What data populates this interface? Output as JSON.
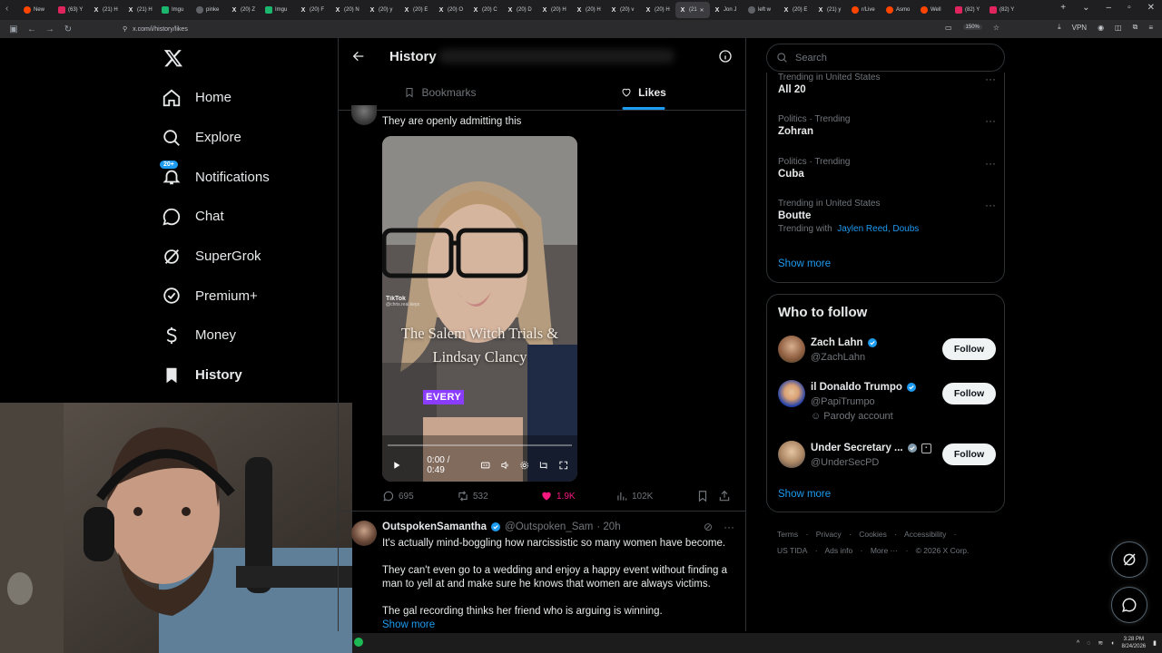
{
  "browser": {
    "tabs": [
      {
        "label": "New",
        "icon": "reddit"
      },
      {
        "label": "(63) Y",
        "icon": "youtube"
      },
      {
        "label": "(21) H",
        "icon": "x"
      },
      {
        "label": "(21) H",
        "icon": "x"
      },
      {
        "label": "Imgu",
        "icon": "imgur"
      },
      {
        "label": "pinke",
        "icon": "globe"
      },
      {
        "label": "(20) Z",
        "icon": "x"
      },
      {
        "label": "Imgu",
        "icon": "imgur"
      },
      {
        "label": "(20) F",
        "icon": "x"
      },
      {
        "label": "(20) N",
        "icon": "x"
      },
      {
        "label": "(20) y",
        "icon": "x"
      },
      {
        "label": "(20) E",
        "icon": "x"
      },
      {
        "label": "(20) O",
        "icon": "x"
      },
      {
        "label": "(20) C",
        "icon": "x"
      },
      {
        "label": "(20) D",
        "icon": "x"
      },
      {
        "label": "(20) H",
        "icon": "x"
      },
      {
        "label": "(20) H",
        "icon": "x"
      },
      {
        "label": "(20) v",
        "icon": "x"
      },
      {
        "label": "(20) H",
        "icon": "x"
      },
      {
        "label": "(21",
        "icon": "x",
        "active": true
      },
      {
        "label": "Jon J",
        "icon": "x"
      },
      {
        "label": "left w",
        "icon": "globe"
      },
      {
        "label": "(20) E",
        "icon": "x"
      },
      {
        "label": "(21) y",
        "icon": "x"
      },
      {
        "label": "r/Live",
        "icon": "reddit"
      },
      {
        "label": "Asmo",
        "icon": "reddit"
      },
      {
        "label": "Well",
        "icon": "reddit"
      },
      {
        "label": "(82) Y",
        "icon": "youtube"
      },
      {
        "label": "(82) Y",
        "icon": "youtube"
      }
    ],
    "url": "x.com/i/history/likes",
    "zoom": "150%",
    "vpn": "VPN"
  },
  "nav": {
    "logo": "x-logo-icon",
    "items": [
      {
        "label": "Home",
        "icon": "home-icon"
      },
      {
        "label": "Explore",
        "icon": "search-icon"
      },
      {
        "label": "Notifications",
        "icon": "bell-icon",
        "badge": "20+"
      },
      {
        "label": "Chat",
        "icon": "chat-icon"
      },
      {
        "label": "SuperGrok",
        "icon": "grok-icon"
      },
      {
        "label": "Premium+",
        "icon": "premium-icon"
      },
      {
        "label": "Money",
        "icon": "money-icon"
      },
      {
        "label": "History",
        "icon": "bookmark-icon",
        "active": true
      }
    ]
  },
  "main": {
    "title": "History",
    "tabs": [
      {
        "label": "Bookmarks",
        "active": false
      },
      {
        "label": "Likes",
        "active": true
      }
    ],
    "tweet1": {
      "text": "They are openly admitting this",
      "video": {
        "overlay_title_line1": "The Salem Witch Trials &",
        "overlay_title_line2": "Lindsay Clancy",
        "caption": "EVERY",
        "tiktok_label": "TikTok",
        "tiktok_user": "@chris.real.keys",
        "time": "0:00 / 0:49",
        "progress": 0
      },
      "stats": {
        "replies": "695",
        "reposts": "532",
        "likes": "1.9K",
        "views": "102K"
      }
    },
    "tweet2": {
      "name": "OutspokenSamantha",
      "handle": "@Outspoken_Sam",
      "time": "· 20h",
      "para1": "It's actually mind-boggling how narcissistic so many women have become.",
      "para2": "They can't even go to a wedding and enjoy a happy event without finding a man to yell at and make sure he knows that women are always victims.",
      "para3": "The gal recording thinks her friend who is arguing is winning.",
      "show_more": "Show more"
    }
  },
  "sidebar": {
    "search_placeholder": "Search",
    "trends": [
      {
        "context": "Trending in United States",
        "name": "All 20"
      },
      {
        "context": "Politics · Trending",
        "name": "Zohran"
      },
      {
        "context": "Politics · Trending",
        "name": "Cuba"
      },
      {
        "context": "Trending in United States",
        "name": "Boutte",
        "with_label": "Trending with",
        "with_topics": "Jaylen Reed, Doubs"
      }
    ],
    "trends_show_more": "Show more",
    "who_to_follow": {
      "title": "Who to follow",
      "accounts": [
        {
          "name": "Zach Lahn",
          "handle": "@ZachLahn",
          "button": "Follow"
        },
        {
          "name": "il Donaldo Trumpo",
          "handle": "@PapiTrumpo",
          "parody": "Parody account",
          "button": "Follow"
        },
        {
          "name": "Under Secretary ...",
          "handle": "@UnderSecPD",
          "button": "Follow"
        }
      ],
      "show_more": "Show more"
    },
    "footer": {
      "links": [
        "Terms",
        "Privacy",
        "Cookies",
        "Accessibility",
        "US TIDA",
        "Ads info",
        "More ···"
      ],
      "copyright": "© 2026 X Corp."
    }
  },
  "taskbar": {
    "time": "3:28 PM",
    "date": "8/24/2026"
  },
  "colors": {
    "accent": "#1d9bf0",
    "like": "#f91880",
    "bg": "#000000",
    "muted": "#71767b"
  }
}
